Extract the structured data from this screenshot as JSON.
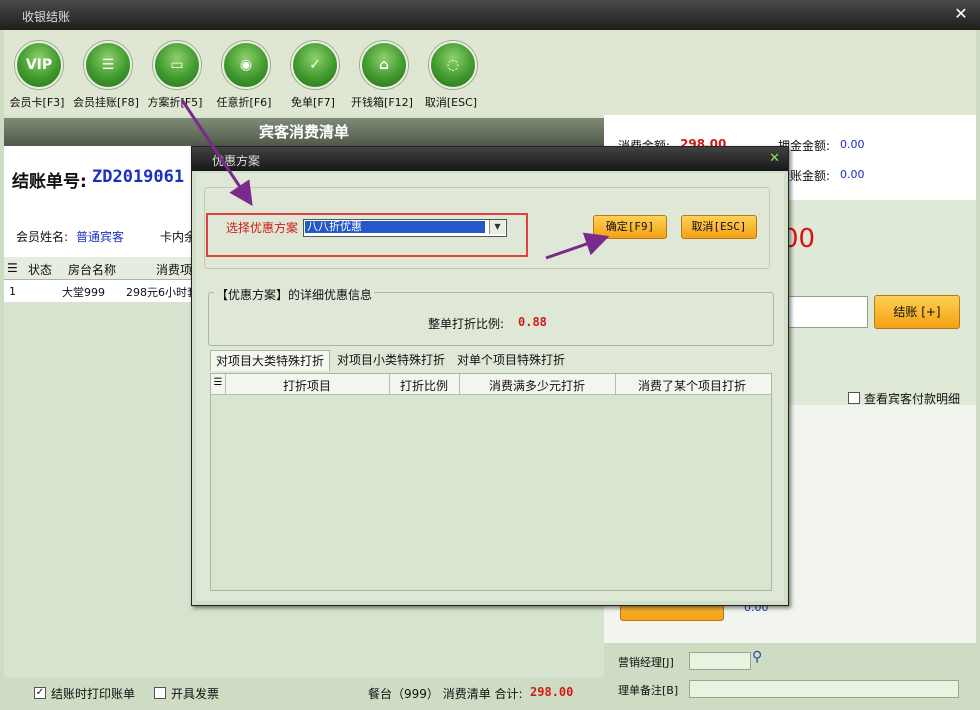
{
  "window": {
    "title": "收银结账"
  },
  "toolbar": {
    "items": [
      {
        "label": "会员卡[F3]",
        "icon": "vip-card-icon",
        "glyph": "VIP"
      },
      {
        "label": "会员挂账[F8]",
        "icon": "member-credit-icon",
        "glyph": "☰"
      },
      {
        "label": "方案折[F5]",
        "icon": "plan-discount-icon",
        "glyph": "▭"
      },
      {
        "label": "任意折[F6]",
        "icon": "custom-discount-icon",
        "glyph": "◉"
      },
      {
        "label": "免单[F7]",
        "icon": "free-bill-icon",
        "glyph": "✓"
      },
      {
        "label": "开钱箱[F12]",
        "icon": "cash-drawer-icon",
        "glyph": "⌂"
      },
      {
        "label": "取消[ESC]",
        "icon": "cancel-icon",
        "glyph": "◌"
      }
    ]
  },
  "left": {
    "header": "宾客消费清单",
    "bill_label": "结账单号:",
    "bill_no": "ZD2019061",
    "member_label": "会员姓名:",
    "member_value": "普通宾客",
    "card_label": "卡内余",
    "columns": [
      "状态",
      "房台名称",
      "消费项"
    ],
    "rows": [
      {
        "no": "1",
        "status": "",
        "room": "大堂999",
        "item": "298元6小时套"
      }
    ]
  },
  "footer": {
    "print_label": "结账时打印账单",
    "print_checked": "✓",
    "invoice_label": "开具发票",
    "table_info": "餐台（999） 消费清单 合计:",
    "total": "298.00"
  },
  "right": {
    "consume_label": "消费金额:",
    "consume_value": "298.00",
    "deposit_label": "押金金额:",
    "deposit_value": "0.00",
    "credit_label": "挂账金额:",
    "credit_value": "0.00",
    "big_amount": "00",
    "checkout_label": "结账 [+]",
    "view_detail_label": "查看宾客付款明细",
    "small_value": "0.00",
    "manager_label": "营销经理[J]",
    "remark_label": "理单备注[B]"
  },
  "dialog": {
    "title": "优惠方案",
    "select_label": "选择优惠方案",
    "selected_plan": "八八折优惠",
    "ok_label": "确定[F9]",
    "cancel_label": "取消[ESC]",
    "detail_title": "【优惠方案】的详细优惠信息",
    "ratio_label": "整单打折比例:",
    "ratio_value": "0.88",
    "tabs": [
      "对项目大类特殊打折",
      "对项目小类特殊打折",
      "对单个项目特殊打折"
    ],
    "columns": [
      "打折项目",
      "打折比例",
      "消费满多少元打折",
      "消费了某个项目打折"
    ]
  },
  "colors": {
    "accent": "#d01a1a",
    "link": "#1a2fbf",
    "annotation_arrow": "#7a2a8a"
  }
}
